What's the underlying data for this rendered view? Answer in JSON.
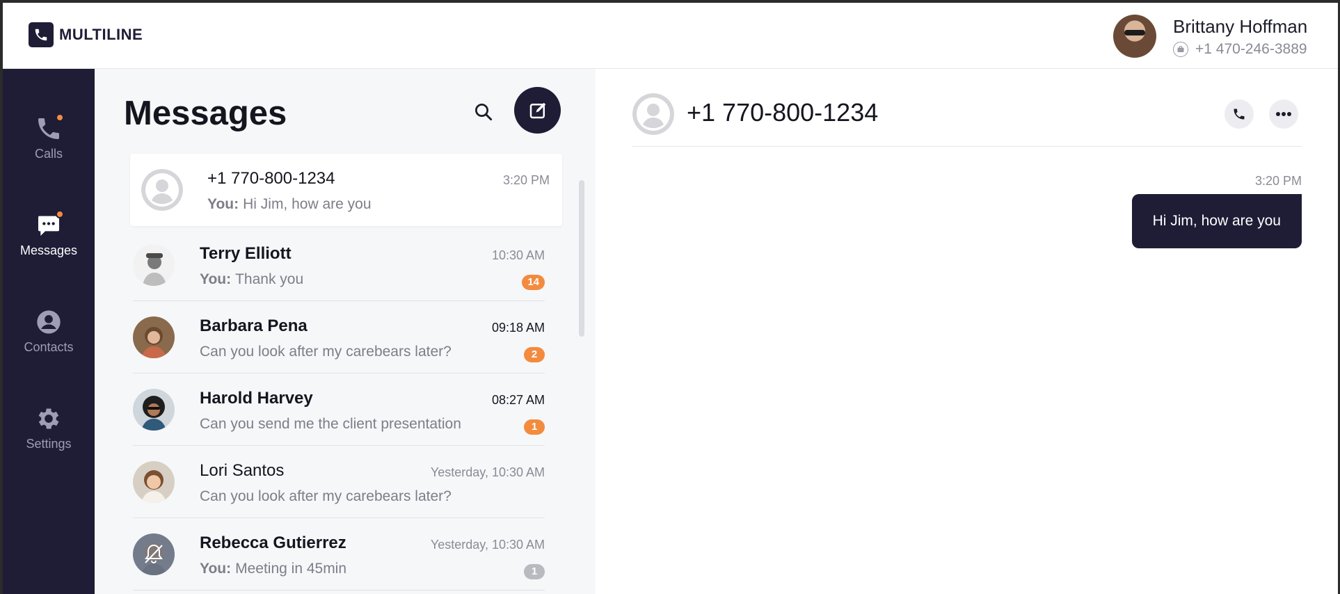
{
  "app": {
    "logo_text": "MULTILINE"
  },
  "user": {
    "name": "Brittany Hoffman",
    "phone": "+1 470-246-3889"
  },
  "nav": {
    "items": [
      {
        "label": "Calls",
        "icon": "phone-icon",
        "active": false,
        "has_dot": true
      },
      {
        "label": "Messages",
        "icon": "chat-icon",
        "active": true,
        "has_dot": true
      },
      {
        "label": "Contacts",
        "icon": "contact-icon",
        "active": false,
        "has_dot": false
      },
      {
        "label": "Settings",
        "icon": "gear-icon",
        "active": false,
        "has_dot": false
      }
    ]
  },
  "messages": {
    "title": "Messages",
    "conversations": [
      {
        "name": "+1 770-800-1234",
        "prefix": "You:",
        "preview": "Hi Jim, how are you",
        "time": "3:20 PM",
        "badge": "",
        "selected": true
      },
      {
        "name": "Terry Elliott",
        "prefix": "You:",
        "preview": "Thank you",
        "time": "10:30 AM",
        "badge": "14",
        "selected": false
      },
      {
        "name": "Barbara Pena",
        "prefix": "",
        "preview": "Can you look after my carebears later?",
        "time": "09:18 AM",
        "badge": "2",
        "selected": false
      },
      {
        "name": "Harold Harvey",
        "prefix": "",
        "preview": "Can you send me the client presentation",
        "time": "08:27 AM",
        "badge": "1",
        "selected": false
      },
      {
        "name": "Lori Santos",
        "prefix": "",
        "preview": "Can you look after my carebears later?",
        "time": "Yesterday, 10:30 AM",
        "badge": "",
        "selected": false
      },
      {
        "name": "Rebecca Gutierrez",
        "prefix": "You:",
        "preview": "Meeting in 45min",
        "time": "Yesterday, 10:30 AM",
        "badge": "1",
        "selected": false
      }
    ]
  },
  "chat": {
    "title": "+1 770-800-1234",
    "messages": [
      {
        "time": "3:20 PM",
        "text": "Hi Jim, how are you",
        "direction": "outgoing"
      }
    ]
  },
  "colors": {
    "nav_bg": "#1f1c36",
    "accent": "#f38b3f",
    "list_bg": "#f6f7f9",
    "bubble_bg": "#1f1c36"
  }
}
